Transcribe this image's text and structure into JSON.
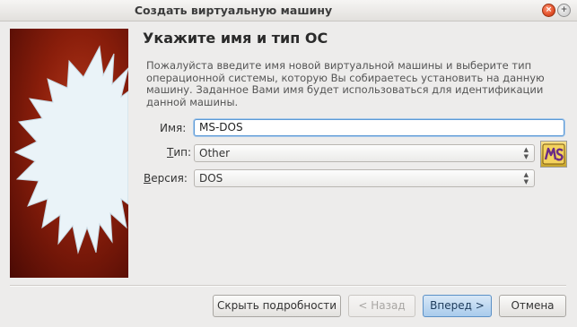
{
  "window": {
    "title": "Создать виртуальную машину",
    "close_glyph": "×",
    "max_glyph": "+"
  },
  "page": {
    "heading": "Укажите имя и тип ОС",
    "description": "Пожалуйста введите имя новой виртуальной машины и выберите тип операционной системы, которую Вы собираетесь установить на данную машину. Заданное Вами имя будет использоваться для идентификации данной машины."
  },
  "form": {
    "name_label": "Имя:",
    "name_value": "MS-DOS",
    "type_label_prefix": "Т",
    "type_label_rest": "ип:",
    "type_value": "Other",
    "version_label_prefix": "В",
    "version_label_rest": "ерсия:",
    "version_value": "DOS",
    "os_icon": "ms-dos-os-icon"
  },
  "buttons": {
    "details": "Скрыть подробности",
    "back": "< Назад",
    "next": "Вперед >",
    "cancel": "Отмена"
  },
  "colors": {
    "accent": "#5c9ad6",
    "banner": "#8a1e0b"
  }
}
